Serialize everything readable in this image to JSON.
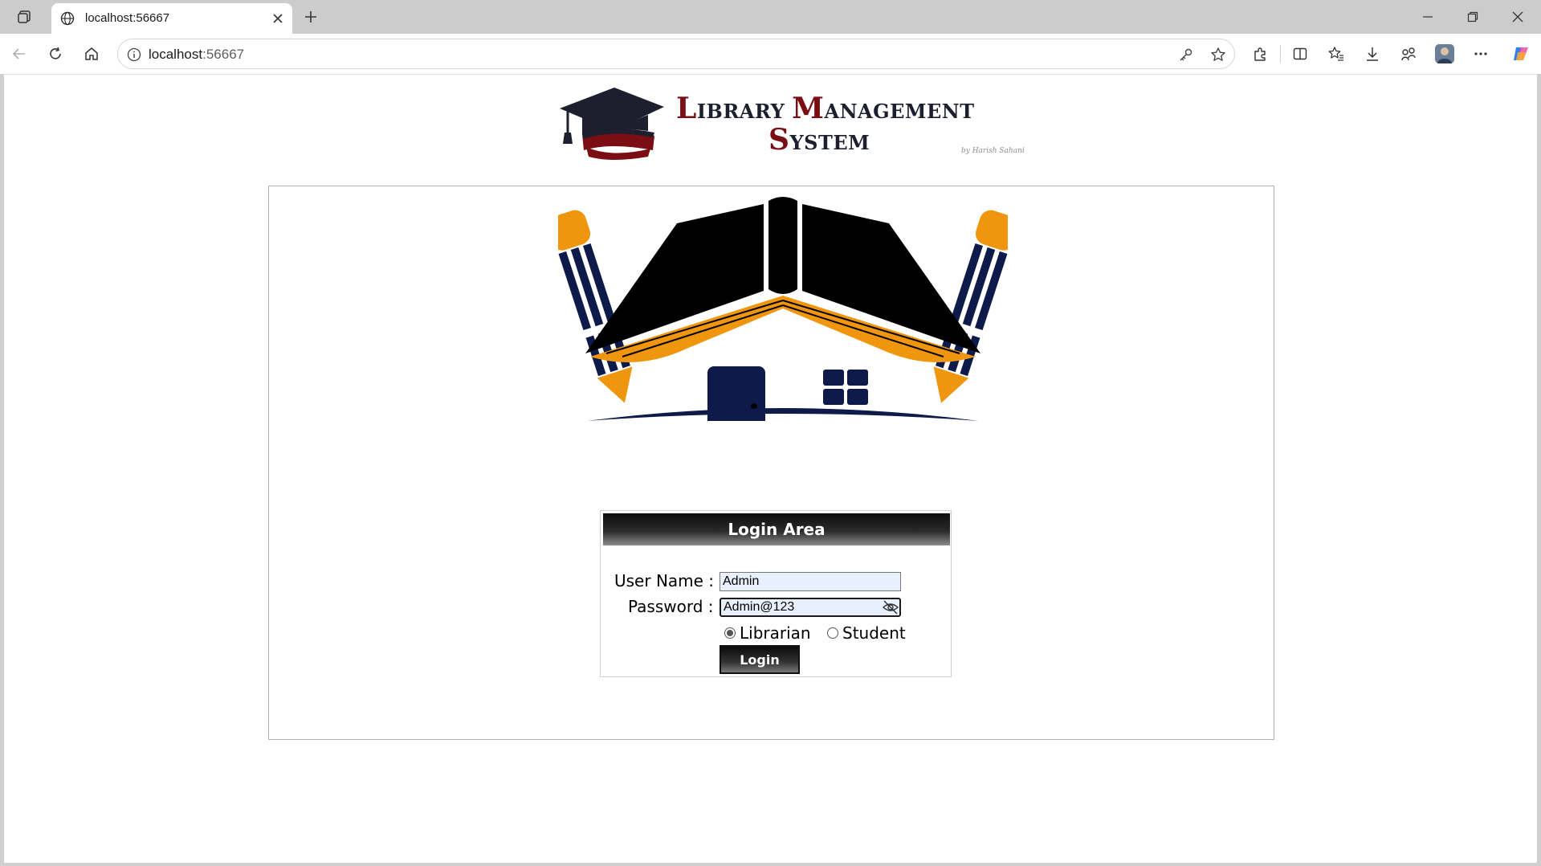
{
  "browser": {
    "tab_title": "localhost:56667",
    "url_host": "localhost",
    "url_port": ":56667"
  },
  "banner": {
    "line1_first": "L",
    "line1_rest_a": "IBRARY ",
    "line1_m": "M",
    "line1_rest_b": "ANAGEMENT",
    "line2_first": "S",
    "line2_rest": "YSTEM",
    "byline": "by Harish Sahani",
    "accent_color": "#7a0e14"
  },
  "login": {
    "header": "Login Area",
    "username_label": "User Name :",
    "username_value": "Admin",
    "password_label": "Password :",
    "password_value": "Admin@123",
    "roles": [
      {
        "label": "Librarian",
        "selected": true
      },
      {
        "label": "Student",
        "selected": false
      }
    ],
    "button_label": "Login"
  },
  "colors": {
    "logo_orange": "#f0960e",
    "logo_navy": "#0d1a4a"
  }
}
